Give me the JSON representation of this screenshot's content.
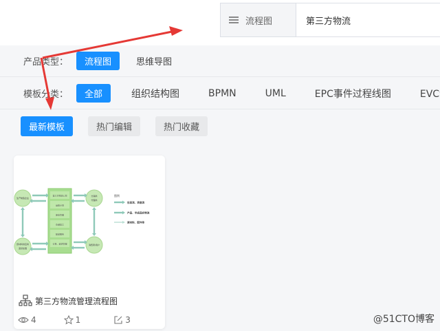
{
  "header": {
    "type_label": "流程图",
    "search_value": "第三方物流"
  },
  "filters": {
    "product_type_label": "产品类型：",
    "product_types": [
      "流程图",
      "思维导图"
    ],
    "template_category_label": "模板分类：",
    "categories": [
      "全部",
      "组织结构图",
      "BPMN",
      "UML",
      "EPC事件过程线图",
      "EVC企业"
    ],
    "tabs": [
      "最新模板",
      "热门编辑",
      "热门收藏"
    ]
  },
  "card": {
    "title": "第三方物流管理流程图",
    "views": "4",
    "stars": "1",
    "edits": "3",
    "diagram": {
      "left_top": "生产制造企业",
      "left_bottom_1": "原材料供应商",
      "left_bottom_2": "退货处理",
      "center": [
        "第三方物流公司",
        "运输计划",
        "库存管理",
        "仓储加工",
        "配送服务",
        "订单、退货管理"
      ],
      "right_top_1": "分销商",
      "right_top_2": "代理商",
      "right_bottom": "消费者/用户",
      "legend_title": "图例",
      "legend": [
        "信息流、资金流",
        "产品、半成品实物流",
        "原材料、配件等"
      ]
    }
  },
  "watermark": "@51CTO博客",
  "colors": {
    "accent": "#1890ff",
    "annotation": "#e53935",
    "diagram_green": "#a8dd90"
  }
}
